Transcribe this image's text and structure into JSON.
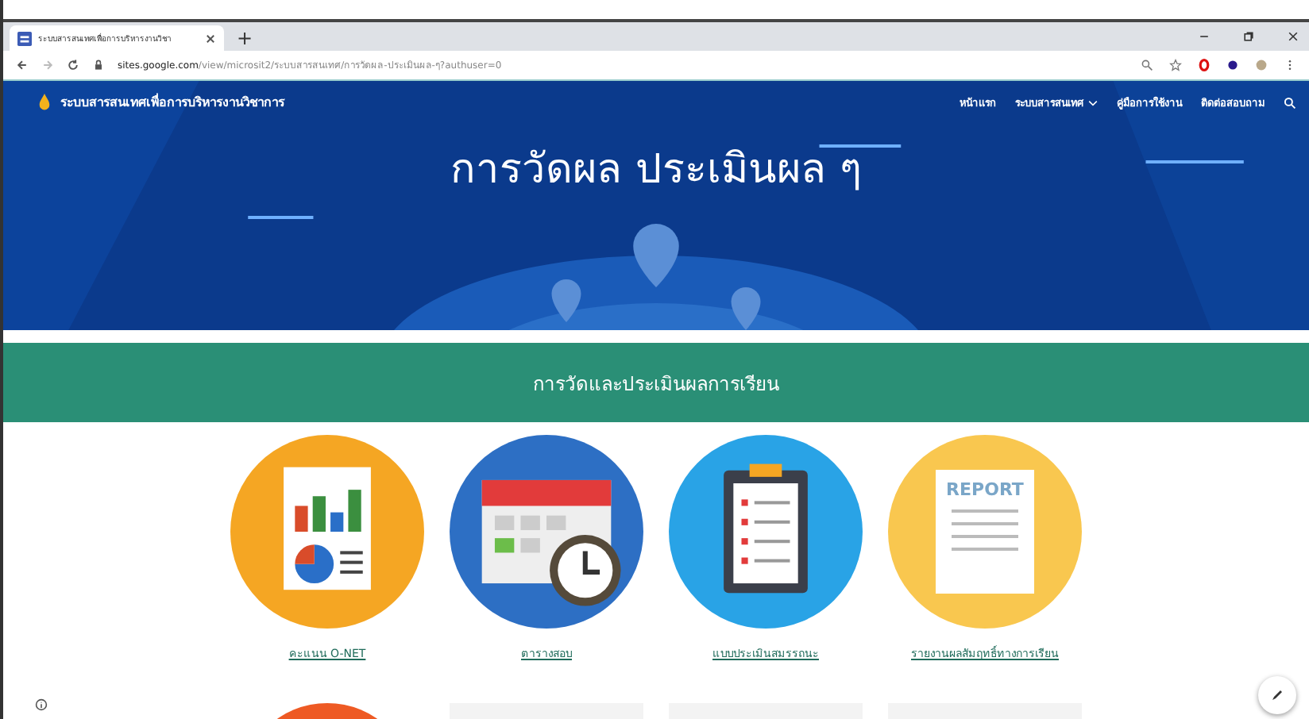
{
  "browser": {
    "tab_title": "ระบบสารสนเทศเพื่อการบริหารงานวิชา",
    "new_tab": "+",
    "url_host": "sites.google.com",
    "url_path": "/view/microsit2/ระบบสารสนเทศ/การวัดผล-ประเมินผล-ๆ?authuser=0"
  },
  "site": {
    "title": "ระบบสารสนเทศเพื่อการบริหารงานวิชาการ",
    "nav": [
      {
        "label": "หน้าแรก",
        "dropdown": false
      },
      {
        "label": "ระบบสารสนเทศ",
        "dropdown": true
      },
      {
        "label": "คู่มือการใช้งาน",
        "dropdown": false
      },
      {
        "label": "ติดต่อสอบถาม",
        "dropdown": false
      }
    ]
  },
  "hero": {
    "title": "การวัดผล ประเมินผล ๆ"
  },
  "section": {
    "title": "การวัดและประเมินผลการเรียน"
  },
  "cards": [
    {
      "kind": "chart",
      "label": "คะแนน O-NET"
    },
    {
      "kind": "calendar",
      "label": "ตารางสอบ"
    },
    {
      "kind": "clipboard",
      "label": "แบบประเมินสมรรถนะ"
    },
    {
      "kind": "report",
      "label": "รายงานผลสัมฤทธิ์ทางการเรียน",
      "badge": "REPORT"
    }
  ],
  "second_row": [
    {
      "kind": "circle"
    },
    {
      "kind": "card"
    },
    {
      "kind": "card"
    },
    {
      "kind": "card"
    }
  ]
}
